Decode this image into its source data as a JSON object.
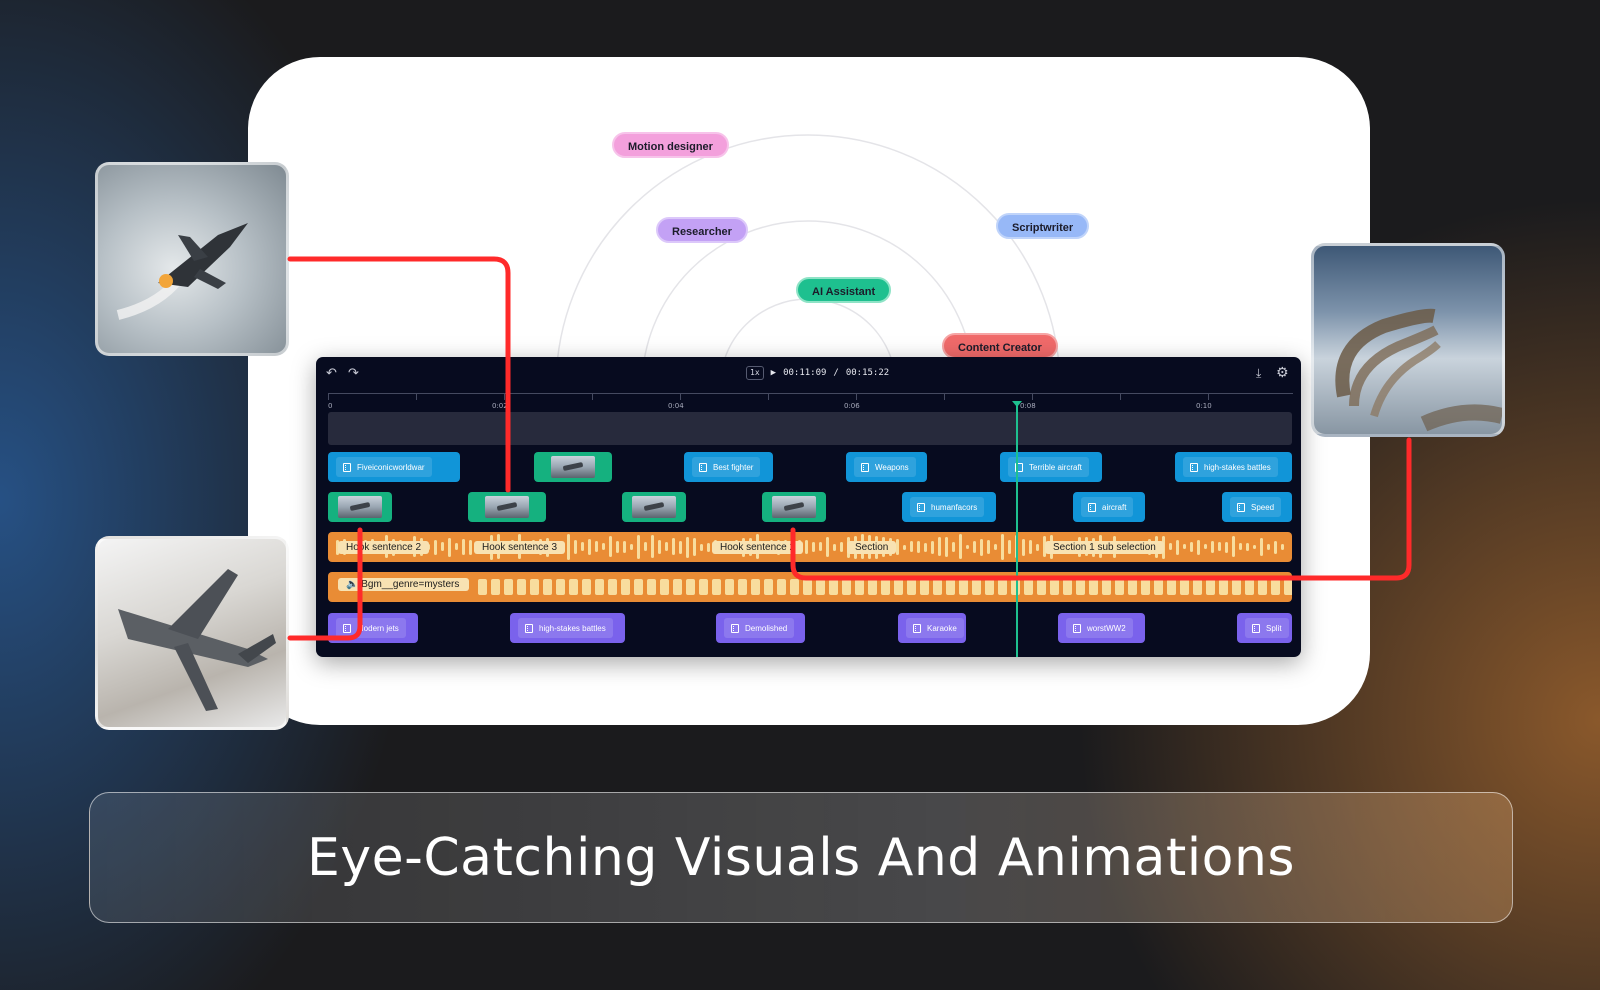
{
  "roles": {
    "motion_designer": "Motion designer",
    "researcher": "Researcher",
    "scriptwriter": "Scriptwriter",
    "ai_assistant": "AI Assistant",
    "content_creator": "Content Creator"
  },
  "player": {
    "speed": "1x",
    "current_time": "00:11:09",
    "separator": "/",
    "total_time": "00:15:22"
  },
  "ruler": {
    "labels": [
      "0",
      "0:02",
      "0:04",
      "0:06",
      "0:08",
      "0:10"
    ]
  },
  "tracks": {
    "video1": [
      "Fiveiconicworldwar",
      "Best fighter",
      "Weapons",
      "Terrible aircraft",
      "high-stakes battles"
    ],
    "video2": [
      "humanfacors",
      "aircraft",
      "Speed"
    ],
    "voice": [
      "Hook sentence 2",
      "Hook sentence 3",
      "Hook sentence 2",
      "Section",
      "Section 1 sub selection"
    ],
    "bgm": "Bgm__genre=mysters",
    "text": [
      "Modern jets",
      "high-stakes battles",
      "Demolished",
      "Karaoke",
      "worstWW2",
      "Split"
    ]
  },
  "banner": {
    "title": "Eye-Catching Visuals And Animations"
  },
  "colors": {
    "accent_line": "#ff2a2a",
    "clip_blue": "#1195d8",
    "clip_green": "#15b17f",
    "clip_purple": "#7a62ec",
    "audio_orange": "#e98c35",
    "playhead": "#1ec08f"
  }
}
